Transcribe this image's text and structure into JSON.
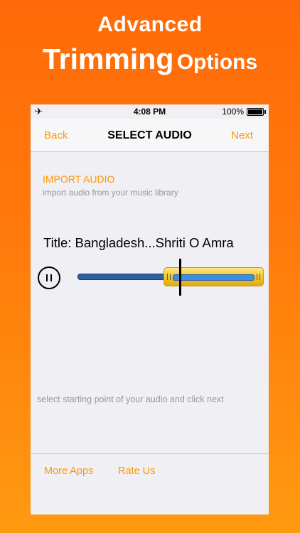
{
  "promo": {
    "line1": "Advanced",
    "line2_big": "Trimming",
    "line2_small": "Options"
  },
  "status_bar": {
    "time": "4:08 PM",
    "battery_pct": "100%"
  },
  "nav": {
    "back_label": "Back",
    "title": "SELECT AUDIO",
    "next_label": "Next"
  },
  "import": {
    "title": "IMPORT AUDIO",
    "subtitle": "import audio from your music library"
  },
  "song": {
    "title": "Title: Bangladesh...Shriti O Amra"
  },
  "hint": "select starting point of your audio and click next",
  "bottom": {
    "more_apps": "More Apps",
    "rate_us": "Rate Us"
  }
}
